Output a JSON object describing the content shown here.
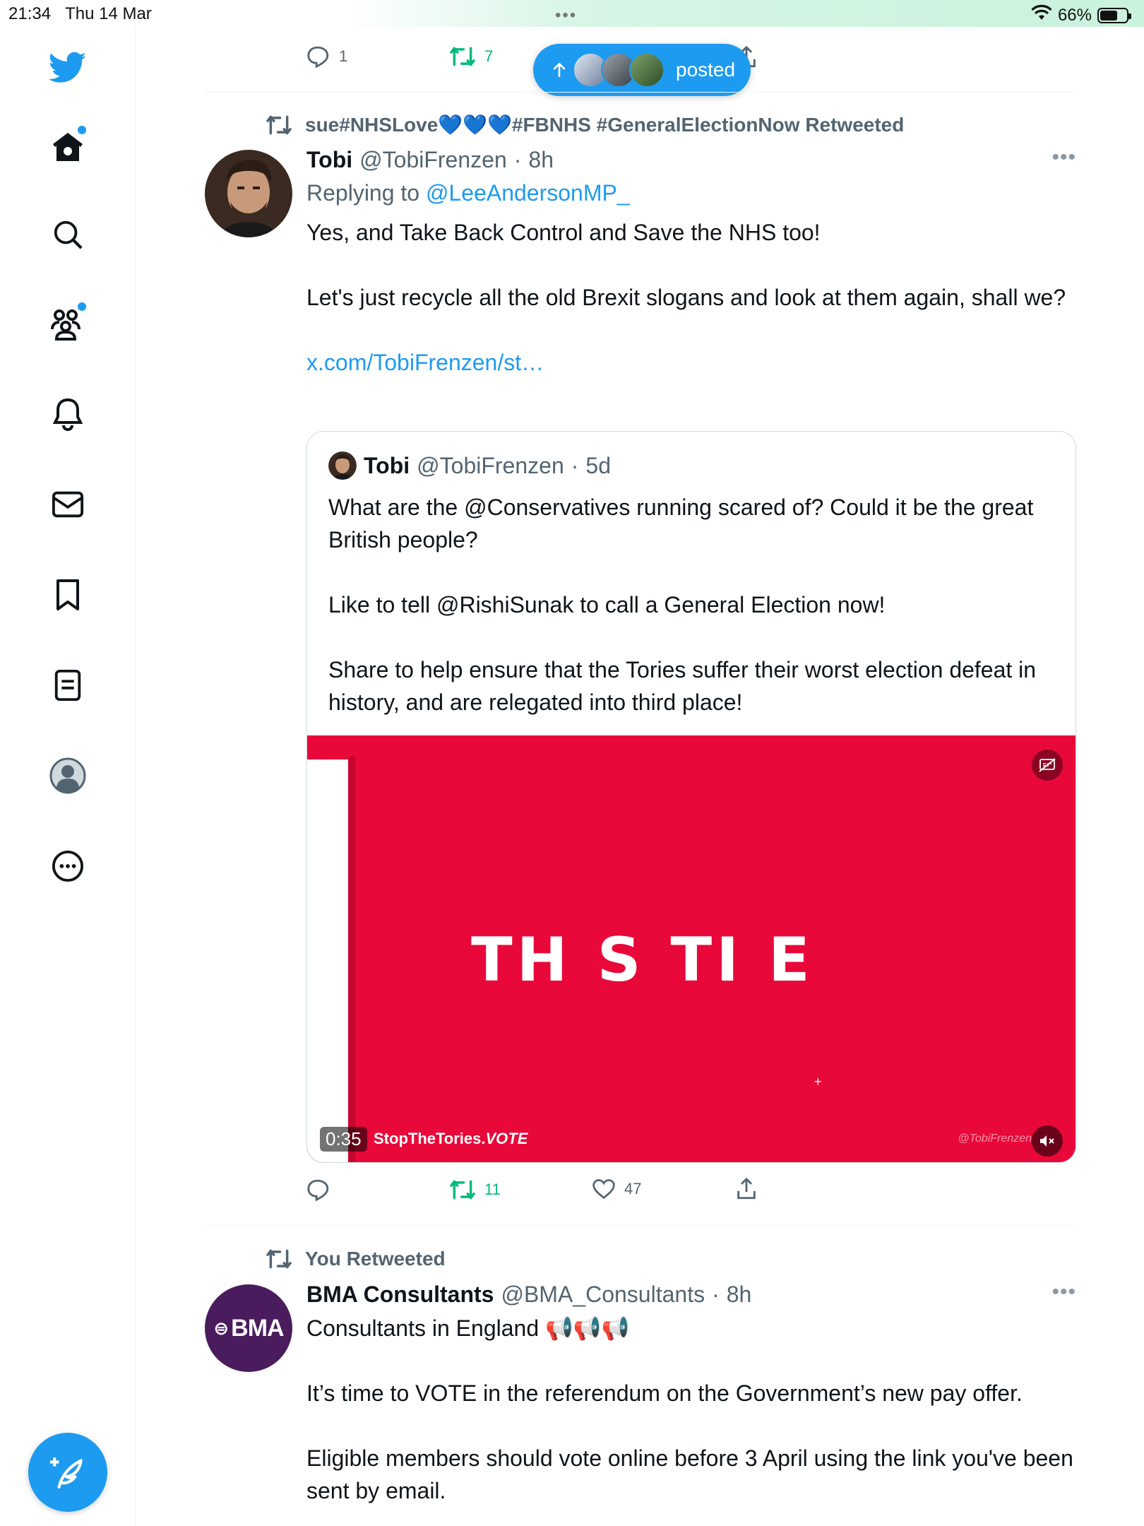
{
  "status_bar": {
    "time": "21:34",
    "date": "Thu 14 Mar",
    "dots": "•••",
    "battery": "66%",
    "battery_level": 0.66
  },
  "new_posts_pill": {
    "label": "posted"
  },
  "prev_tweet_actions": {
    "replies": "1",
    "retweets": "7"
  },
  "tweet1": {
    "social_context": "sue#NHSLove💙💙💙#FBNHS #GeneralElectionNow Retweeted",
    "name": "Tobi",
    "handle": "@TobiFrenzen",
    "sep": "·",
    "time": "8h",
    "replying_prefix": "Replying to",
    "replying_to": "@LeeAndersonMP_",
    "text": "Yes, and Take Back Control and Save the NHS too!\n\nLet's just recycle all the old Brexit slogans and look at them again, shall we?",
    "link": "x.com/TobiFrenzen/st…",
    "more": "•••",
    "quote": {
      "name": "Tobi",
      "handle": "@TobiFrenzen",
      "sep": "·",
      "time": "5d",
      "text": "What are the @Conservatives running scared of? Could it be the great British people?\n\nLike to tell @RishiSunak to call a General Election now!\n\nShare to help ensure that the Tories suffer their worst election defeat in history, and are relegated into third place!",
      "video": {
        "title": "TH S TI   E",
        "brand_prefix": "StopTheTories.",
        "brand_suffix": "VOTE",
        "duration": "0:35",
        "watermark": "@TobiFrenzen",
        "plus": "+"
      }
    },
    "actions": {
      "retweets": "11",
      "likes": "47"
    }
  },
  "tweet2": {
    "social_context": "You Retweeted",
    "avatar_text": "BMA",
    "name": "BMA Consultants",
    "handle": "@BMA_Consultants",
    "sep": "·",
    "time": "8h",
    "more": "•••",
    "text": "Consultants in England 📢📢📢\n\nIt’s time to VOTE in the referendum on the Government’s new pay offer.\n\nEligible members should vote online before 3 April using the link you've been sent by email."
  },
  "colors": {
    "accent": "#1d9bf0",
    "retweet": "#00ba7c",
    "video_bg": "#e8083a",
    "bma": "#4a1c5d"
  }
}
